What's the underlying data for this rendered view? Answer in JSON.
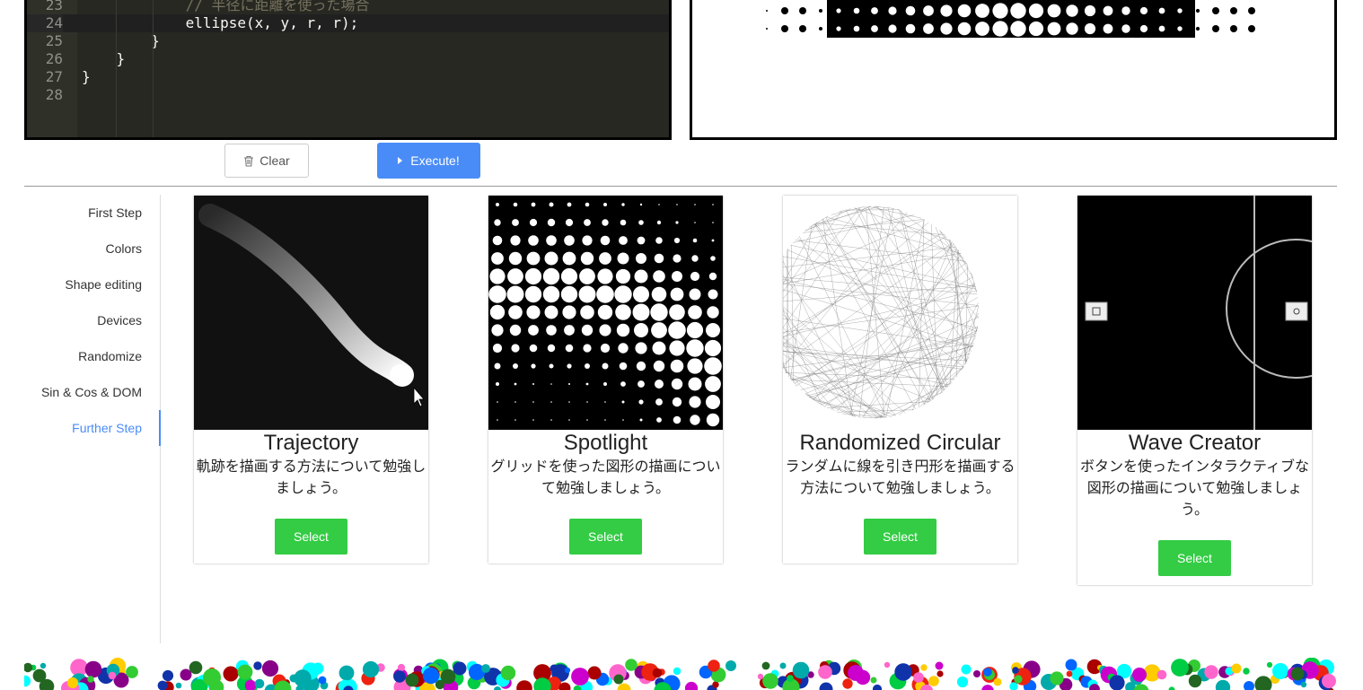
{
  "editor": {
    "lines": [
      {
        "num": "23",
        "text": "            // 半径に距離を使った場合",
        "comment": true
      },
      {
        "num": "24",
        "text": "            ellipse(x, y, r, r);",
        "active": true
      },
      {
        "num": "25",
        "text": "        }"
      },
      {
        "num": "26",
        "text": "    }"
      },
      {
        "num": "27",
        "text": "}"
      },
      {
        "num": "28",
        "text": ""
      }
    ]
  },
  "toolbar": {
    "clear_label": "Clear",
    "execute_label": "Execute!",
    "execute_color": "#4a8cf7"
  },
  "sidebar": {
    "items": [
      {
        "label": "First Step"
      },
      {
        "label": "Colors"
      },
      {
        "label": "Shape editing"
      },
      {
        "label": "Devices"
      },
      {
        "label": "Randomize"
      },
      {
        "label": "Sin & Cos & DOM"
      },
      {
        "label": "Further Step",
        "active": true
      }
    ],
    "active_color": "#4a8cf7"
  },
  "cards": [
    {
      "title": "Trajectory",
      "description": "軌跡を描画する方法について勉強しましょう。",
      "button": "Select"
    },
    {
      "title": "Spotlight",
      "description": "グリッドを使った図形の描画について勉強しましょう。",
      "button": "Select"
    },
    {
      "title": "Randomized Circular",
      "description": "ランダムに線を引き円形を描画する方法について勉強しましょう。",
      "button": "Select"
    },
    {
      "title": "Wave Creator",
      "description": "ボタンを使ったインタラクティブな図形の描画について勉強しましょう。",
      "button": "Select"
    }
  ],
  "colors": {
    "select_button": "#33cc44",
    "editor_background": "#272822"
  },
  "icons": {
    "clear": "trash-icon",
    "execute": "play-triangle-icon"
  }
}
